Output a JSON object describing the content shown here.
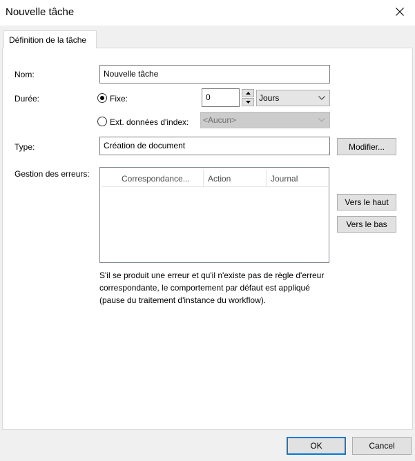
{
  "window": {
    "title": "Nouvelle tâche",
    "close_glyph": "✕"
  },
  "tabs": [
    {
      "label": "Définition de la tâche",
      "selected": true
    }
  ],
  "form": {
    "name": {
      "label": "Nom:",
      "value": "Nouvelle tâche"
    },
    "duration": {
      "label": "Durée:",
      "fixed": {
        "label": "Fixe:",
        "checked": true,
        "value": "0",
        "unit": "Jours"
      },
      "index": {
        "label": "Ext. données d'index:",
        "checked": false,
        "value": "<Aucun>"
      }
    },
    "type": {
      "label": "Type:",
      "value": "Création de document",
      "modify_label": "Modifier..."
    },
    "errors": {
      "label": "Gestion des erreurs:",
      "columns": [
        "Correspondance...",
        "Action",
        "Journal"
      ],
      "rows": [],
      "up_label": "Vers le haut",
      "down_label": "Vers le bas",
      "note": "S'il se produit une erreur et qu'il n'existe pas de règle d'erreur correspondante, le comportement par défaut est appliqué (pause du traitement d'instance du workflow)."
    }
  },
  "footer": {
    "ok_label": "OK",
    "cancel_label": "Cancel"
  },
  "colors": {
    "accent": "#0078d7",
    "background": "#f0f0f0"
  }
}
